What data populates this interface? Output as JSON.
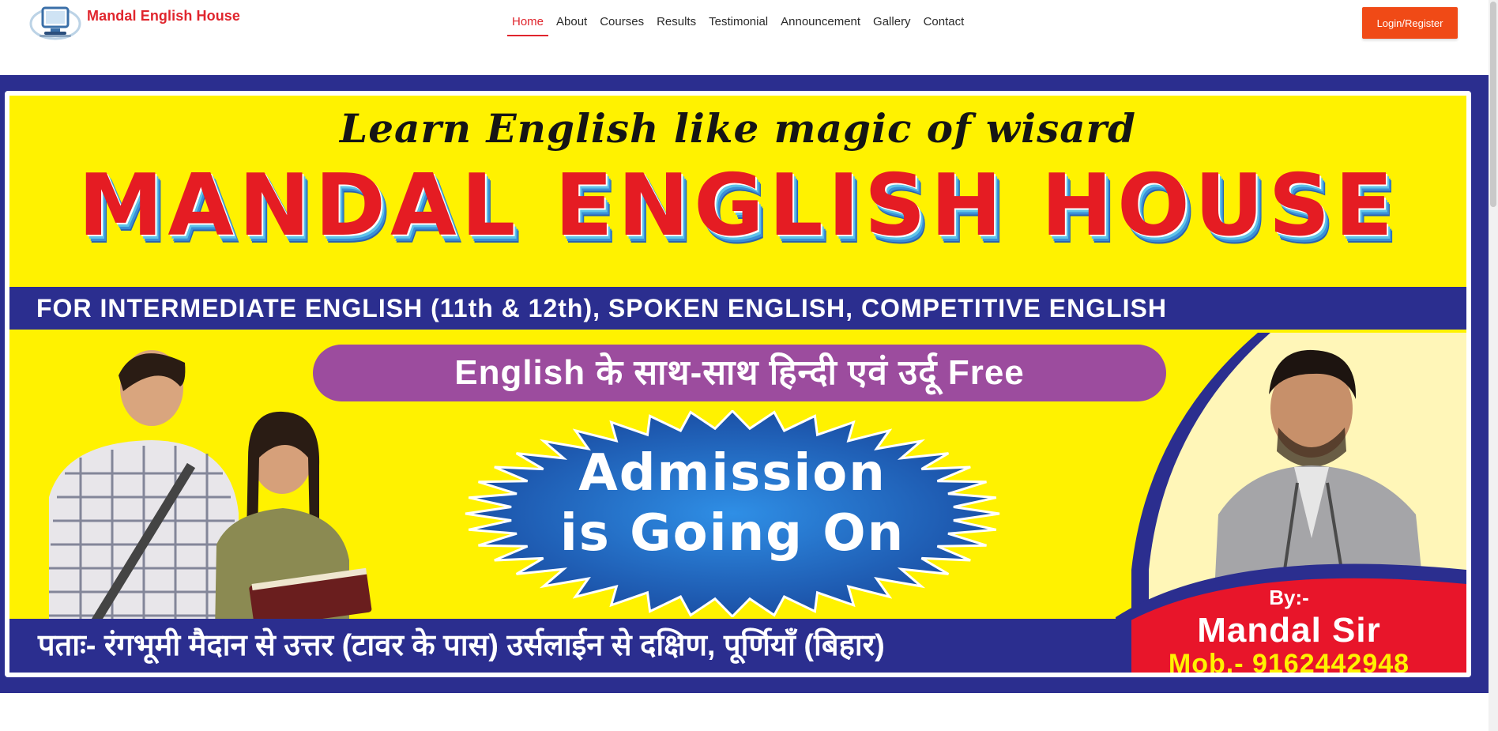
{
  "brand": {
    "name": "Mandal English House",
    "logo_icon": "computer-monitor-logo-icon"
  },
  "nav": {
    "items": [
      {
        "label": "Home",
        "active": true
      },
      {
        "label": "About",
        "active": false
      },
      {
        "label": "Courses",
        "active": false
      },
      {
        "label": "Results",
        "active": false
      },
      {
        "label": "Testimonial",
        "active": false
      },
      {
        "label": "Announcement",
        "active": false
      },
      {
        "label": "Gallery",
        "active": false
      },
      {
        "label": "Contact",
        "active": false
      }
    ],
    "login_label": "Login/Register"
  },
  "hero": {
    "tagline": "Learn English like magic of wisard",
    "title": "MANDAL ENGLISH HOUSE",
    "subtitle": "FOR INTERMEDIATE ENGLISH (11th & 12th), SPOKEN ENGLISH, COMPETITIVE ENGLISH",
    "pill": "English के साथ-साथ हिन्दी एवं उर्दू Free",
    "admission_line1": "Admission",
    "admission_line2": "is Going On",
    "address": "पताः- रंगभूमी मैदान से उत्तर (टावर  के पास) उर्सलाईन से दक्षिण, पूर्णियाँ (बिहार)",
    "by_label": "By:-",
    "teacher_name": "Mandal Sir",
    "mobile": "Mob.- 9162442948"
  },
  "colors": {
    "brand_red": "#e0252d",
    "login_orange": "#f04a16",
    "banner_blue": "#2b2e8f",
    "banner_yellow": "#fff200",
    "title_red": "#e51c23",
    "pill_purple": "#9c4c9e",
    "star_blue": "#1f5fbf"
  }
}
